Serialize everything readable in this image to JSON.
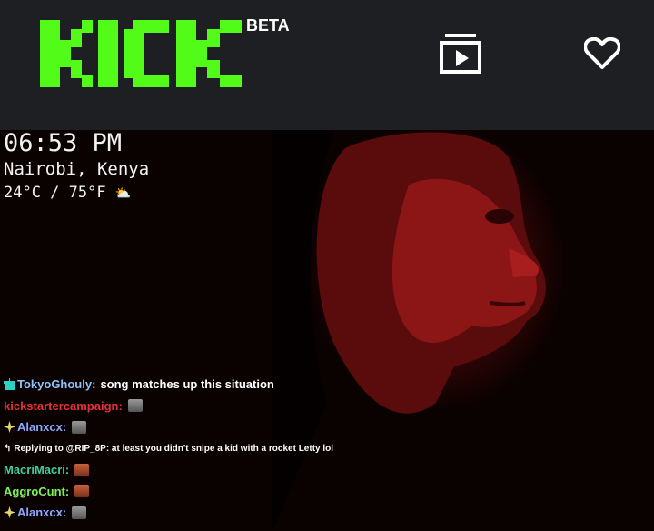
{
  "header": {
    "logo_text": "KICK",
    "beta_label": "BETA",
    "icons": [
      "theatre-mode-icon",
      "heart-icon"
    ],
    "brand_color": "#53fc18"
  },
  "stream_overlay": {
    "time": "06:53 PM",
    "location": "Nairobi, Kenya",
    "temperature": "24°C / 75°F"
  },
  "chat": [
    {
      "badge": "gift-icon",
      "user": "TokyoGhouly:",
      "user_color": "#8ec3ff",
      "text": "song matches up this situation",
      "emote": ""
    },
    {
      "badge": "",
      "user": "kickstartercampaign:",
      "user_color": "#e2333a",
      "text": "",
      "emote": "cat"
    },
    {
      "badge": "sparkle-icon",
      "user": "Alanxcx:",
      "user_color": "#8ea8ff",
      "text": "",
      "emote": "cat"
    },
    {
      "badge": "",
      "user": "",
      "user_color": "#fff",
      "text": "Replying to @RIP_8P: at least you didn't snipe a kid with a rocket Letty lol",
      "emote": "",
      "reply": true
    },
    {
      "badge": "",
      "user": "MacriMacri:",
      "user_color": "#3ecf9a",
      "text": "",
      "emote": "face"
    },
    {
      "badge": "",
      "user": "AggroCunt:",
      "user_color": "#7cf25a",
      "text": "",
      "emote": "face"
    },
    {
      "badge": "sparkle-icon",
      "user": "Alanxcx:",
      "user_color": "#8ea8ff",
      "text": "",
      "emote": "cat"
    }
  ]
}
